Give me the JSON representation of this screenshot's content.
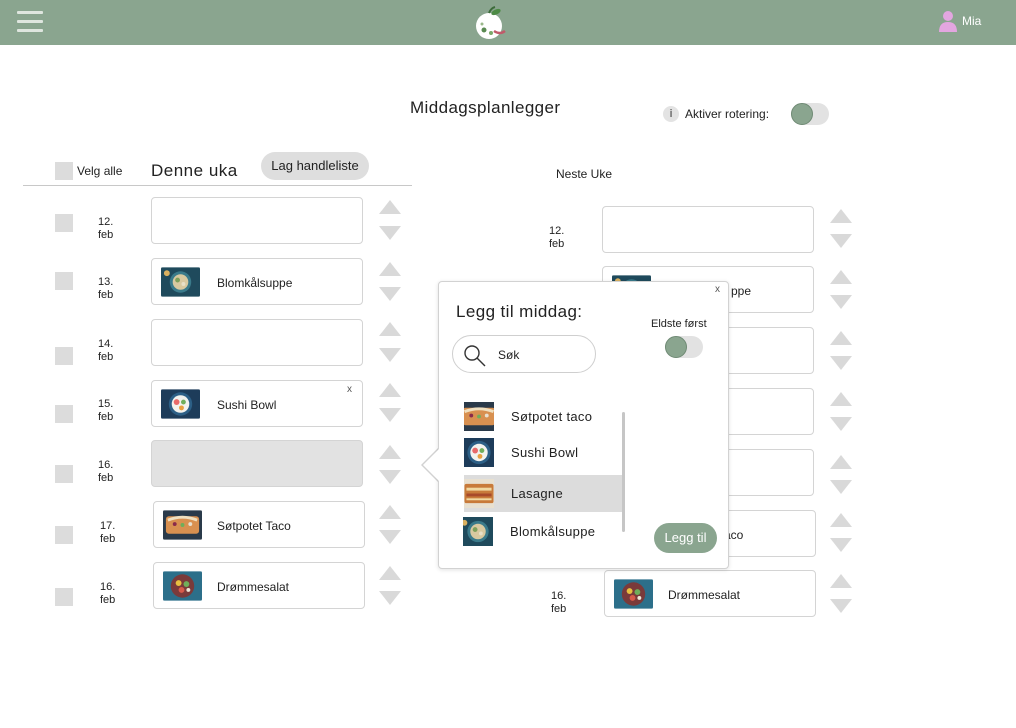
{
  "app": {
    "user_name": "Mia",
    "accent": "#8aa58f"
  },
  "header": {
    "page_title": "Middagsplanlegger",
    "rotation_label": "Aktiver rotering:",
    "info_glyph": "i"
  },
  "this_week": {
    "select_all_label": "Velg alle",
    "title": "Denne uka",
    "shopping_list_button": "Lag handleliste",
    "rows": [
      {
        "day": "12.",
        "month": "feb",
        "dish": ""
      },
      {
        "day": "13.",
        "month": "feb",
        "dish": "Blomkålsuppe"
      },
      {
        "day": "14.",
        "month": "feb",
        "dish": ""
      },
      {
        "day": "15.",
        "month": "feb",
        "dish": "Sushi Bowl",
        "remove": "x"
      },
      {
        "day": "16.",
        "month": "feb",
        "dish": ""
      },
      {
        "day": "17.",
        "month": "feb",
        "dish": "Søtpotet Taco"
      },
      {
        "day": "16.",
        "month": "feb",
        "dish": "Drømmesalat"
      }
    ]
  },
  "next_week": {
    "title": "Neste Uke",
    "rows": [
      {
        "day": "12.",
        "month": "feb",
        "dish": ""
      },
      {
        "day": "",
        "month": "",
        "dish": "ppe"
      },
      {
        "day": "",
        "month": "",
        "dish": ""
      },
      {
        "day": "",
        "month": "",
        "dish": ""
      },
      {
        "day": "",
        "month": "",
        "dish": ""
      },
      {
        "day": "",
        "month": "",
        "dish": "aco"
      },
      {
        "day": "16.",
        "month": "feb",
        "dish": "Drømmesalat"
      }
    ]
  },
  "popup": {
    "title": "Legg til middag:",
    "close": "x",
    "oldest_first_label": "Eldste først",
    "search_placeholder": "Søk",
    "add_button": "Legg til",
    "items": [
      {
        "label": "Søtpotet taco"
      },
      {
        "label": "Sushi Bowl"
      },
      {
        "label": "Lasagne"
      },
      {
        "label": "Blomkålsuppe"
      }
    ],
    "selected_item": "Lasagne"
  },
  "icons": {
    "menu": "hamburger-icon",
    "logo": "apple-logo",
    "user": "user-icon",
    "search": "magnifier-icon",
    "move_up": "triangle-up-icon",
    "move_down": "triangle-down-icon"
  },
  "states": {
    "rotation_enabled": false,
    "oldest_first_enabled": false
  }
}
